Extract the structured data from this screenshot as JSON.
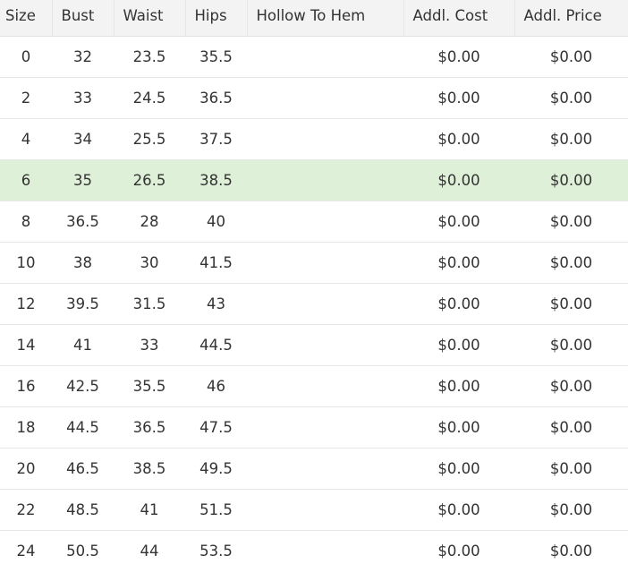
{
  "table": {
    "headers": [
      "Size",
      "Bust",
      "Waist",
      "Hips",
      "Hollow To Hem",
      "Addl. Cost",
      "Addl. Price"
    ],
    "highlight_color": "#dff0d8",
    "rows": [
      {
        "size": "0",
        "bust": "32",
        "waist": "23.5",
        "hips": "35.5",
        "hollow_to_hem": "",
        "addl_cost": "$0.00",
        "addl_price": "$0.00",
        "highlighted": false
      },
      {
        "size": "2",
        "bust": "33",
        "waist": "24.5",
        "hips": "36.5",
        "hollow_to_hem": "",
        "addl_cost": "$0.00",
        "addl_price": "$0.00",
        "highlighted": false
      },
      {
        "size": "4",
        "bust": "34",
        "waist": "25.5",
        "hips": "37.5",
        "hollow_to_hem": "",
        "addl_cost": "$0.00",
        "addl_price": "$0.00",
        "highlighted": false
      },
      {
        "size": "6",
        "bust": "35",
        "waist": "26.5",
        "hips": "38.5",
        "hollow_to_hem": "",
        "addl_cost": "$0.00",
        "addl_price": "$0.00",
        "highlighted": true
      },
      {
        "size": "8",
        "bust": "36.5",
        "waist": "28",
        "hips": "40",
        "hollow_to_hem": "",
        "addl_cost": "$0.00",
        "addl_price": "$0.00",
        "highlighted": false
      },
      {
        "size": "10",
        "bust": "38",
        "waist": "30",
        "hips": "41.5",
        "hollow_to_hem": "",
        "addl_cost": "$0.00",
        "addl_price": "$0.00",
        "highlighted": false
      },
      {
        "size": "12",
        "bust": "39.5",
        "waist": "31.5",
        "hips": "43",
        "hollow_to_hem": "",
        "addl_cost": "$0.00",
        "addl_price": "$0.00",
        "highlighted": false
      },
      {
        "size": "14",
        "bust": "41",
        "waist": "33",
        "hips": "44.5",
        "hollow_to_hem": "",
        "addl_cost": "$0.00",
        "addl_price": "$0.00",
        "highlighted": false
      },
      {
        "size": "16",
        "bust": "42.5",
        "waist": "35.5",
        "hips": "46",
        "hollow_to_hem": "",
        "addl_cost": "$0.00",
        "addl_price": "$0.00",
        "highlighted": false
      },
      {
        "size": "18",
        "bust": "44.5",
        "waist": "36.5",
        "hips": "47.5",
        "hollow_to_hem": "",
        "addl_cost": "$0.00",
        "addl_price": "$0.00",
        "highlighted": false
      },
      {
        "size": "20",
        "bust": "46.5",
        "waist": "38.5",
        "hips": "49.5",
        "hollow_to_hem": "",
        "addl_cost": "$0.00",
        "addl_price": "$0.00",
        "highlighted": false
      },
      {
        "size": "22",
        "bust": "48.5",
        "waist": "41",
        "hips": "51.5",
        "hollow_to_hem": "",
        "addl_cost": "$0.00",
        "addl_price": "$0.00",
        "highlighted": false
      },
      {
        "size": "24",
        "bust": "50.5",
        "waist": "44",
        "hips": "53.5",
        "hollow_to_hem": "",
        "addl_cost": "$0.00",
        "addl_price": "$0.00",
        "highlighted": false
      }
    ]
  }
}
